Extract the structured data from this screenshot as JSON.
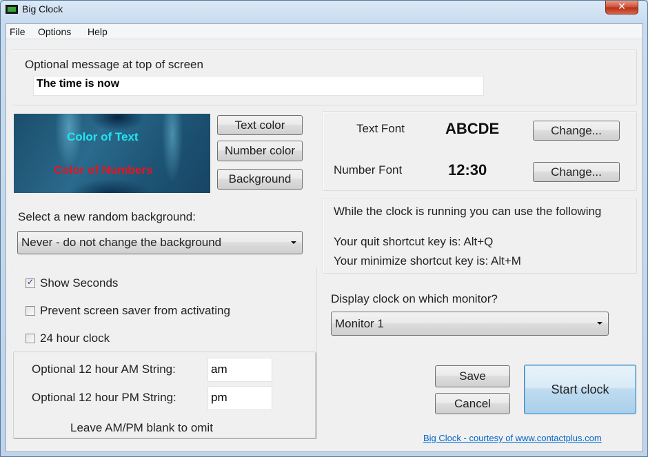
{
  "window": {
    "title": "Big Clock",
    "icon": "clock-app-icon",
    "close_glyph": "✕"
  },
  "menu": [
    "File",
    "Options",
    "Help"
  ],
  "message": {
    "label": "Optional message at top of screen",
    "value": "The time is now"
  },
  "colors": {
    "preview_text": "Color of Text",
    "preview_numbers": "Color of Numbers",
    "text_color_hex": "#22e6f0",
    "number_color_hex": "#e8141e",
    "text_color_button": "Text color",
    "number_color_button": "Number color",
    "background_button": "Background"
  },
  "fonts": {
    "text_font_label": "Text Font",
    "text_font_sample": "ABCDE",
    "number_font_label": "Number Font",
    "number_font_sample": "12:30",
    "change_button": "Change..."
  },
  "shortcuts": {
    "intro": "While the clock is running you can use the following",
    "quit": "Your quit shortcut key is: Alt+Q",
    "minimize": "Your minimize shortcut key is: Alt+M"
  },
  "background_select": {
    "label": "Select a new random background:",
    "selected": "Never - do not change the background"
  },
  "options": {
    "show_seconds": {
      "label": "Show Seconds",
      "checked": true
    },
    "prevent_screensaver": {
      "label": "Prevent screen saver from activating",
      "checked": false
    },
    "hour24": {
      "label": "24 hour clock",
      "checked": false
    }
  },
  "ampm": {
    "am_label": "Optional 12 hour AM String:",
    "am_value": "am",
    "pm_label": "Optional 12 hour PM String:",
    "pm_value": "pm",
    "note": "Leave AM/PM blank to omit"
  },
  "monitor": {
    "label": "Display clock on which monitor?",
    "selected": "Monitor 1"
  },
  "actions": {
    "save": "Save",
    "cancel": "Cancel",
    "start": "Start clock"
  },
  "footer_link": "Big Clock - courtesy of www.contactplus.com"
}
